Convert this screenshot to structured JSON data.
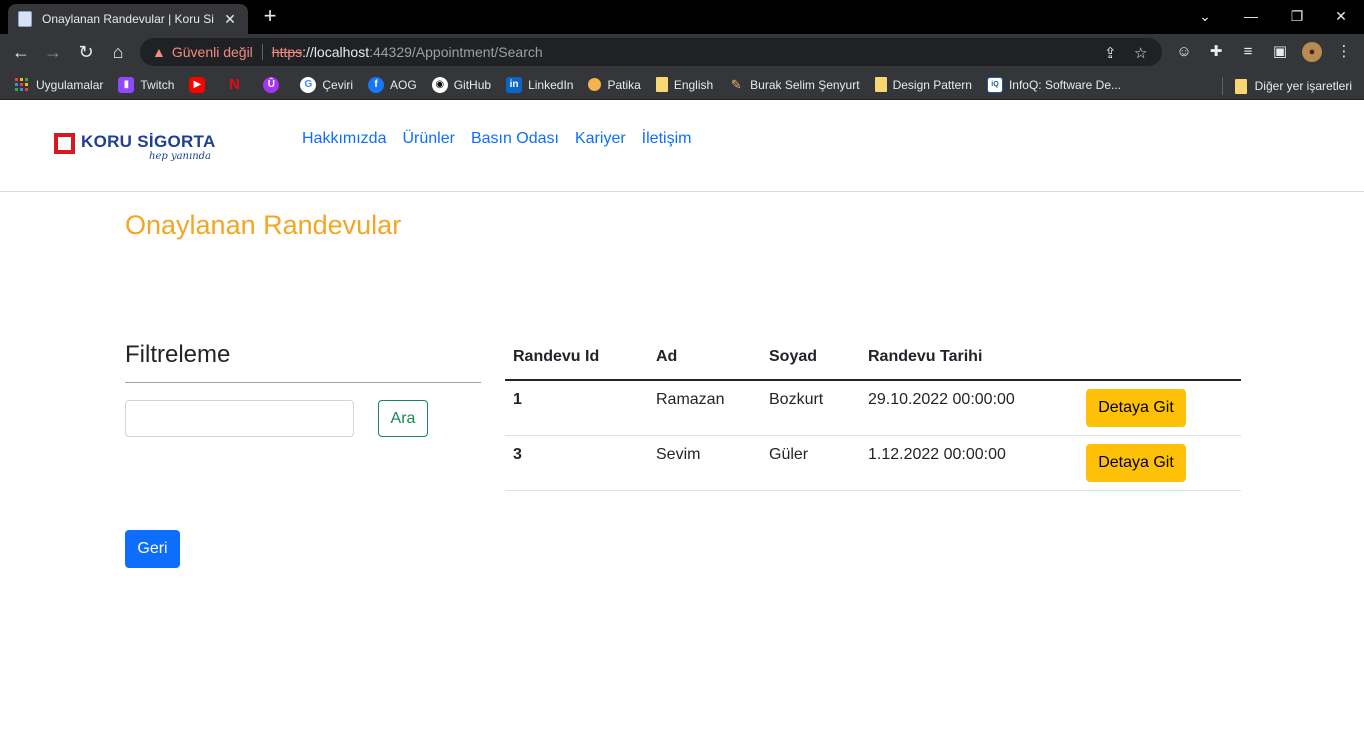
{
  "browser": {
    "tab_title": "Onaylanan Randevular | Koru Sigorta",
    "tab_close": "✕",
    "new_tab": "+",
    "window_controls": {
      "minimize": "—",
      "restore": "❐",
      "close": "✕"
    },
    "nav": {
      "back": "←",
      "forward": "→",
      "reload": "↻",
      "home": "⌂"
    },
    "security_label": "Güvenli değil",
    "url_scheme": "https",
    "url_host": "://localhost",
    "url_rest": ":44329/Appointment/Search",
    "bookmarks": [
      {
        "label": "Uygulamalar",
        "icon": "apps-grid-icon",
        "color": "#e8eaed"
      },
      {
        "label": "Twitch",
        "icon": "twitch-icon",
        "color": "#9146ff"
      },
      {
        "label": "",
        "icon": "youtube-icon",
        "color": "#ff0000"
      },
      {
        "label": "",
        "icon": "netflix-icon",
        "color": "#e50914"
      },
      {
        "label": "",
        "icon": "udemy-icon",
        "color": "#a435f0"
      },
      {
        "label": "Çeviri",
        "icon": "google-icon",
        "color": "#4285f4"
      },
      {
        "label": "AOG",
        "icon": "facebook-icon",
        "color": "#1877f2"
      },
      {
        "label": "GitHub",
        "icon": "github-icon",
        "color": "#ffffff"
      },
      {
        "label": "LinkedIn",
        "icon": "linkedin-icon",
        "color": "#0a66c2"
      },
      {
        "label": "Patika",
        "icon": "patika-icon",
        "color": "#f6b24d"
      },
      {
        "label": "English",
        "icon": "folder-icon",
        "color": "#f7d774"
      },
      {
        "label": "Burak Selim Şenyurt",
        "icon": "pen-icon",
        "color": "#f2b66d"
      },
      {
        "label": "Design Pattern",
        "icon": "folder-icon",
        "color": "#f7d774"
      },
      {
        "label": "InfoQ: Software De...",
        "icon": "infoq-icon",
        "color": "#ffffff"
      }
    ],
    "other_bookmarks": "Diğer yer işaretleri"
  },
  "site": {
    "logo_name": "KORU SİGORTA",
    "logo_tagline": "hep yanında",
    "nav": [
      "Hakkımızda",
      "Ürünler",
      "Basın Odası",
      "Kariyer",
      "İletişim"
    ]
  },
  "main": {
    "title": "Onaylanan Randevular",
    "filter_title": "Filtreleme",
    "search_value": "",
    "search_button": "Ara",
    "back_button": "Geri",
    "table": {
      "headers": [
        "Randevu Id",
        "Ad",
        "Soyad",
        "Randevu Tarihi",
        ""
      ],
      "rows": [
        {
          "id": "1",
          "ad": "Ramazan",
          "soyad": "Bozkurt",
          "tarih": "29.10.2022 00:00:00",
          "action": "Detaya Git"
        },
        {
          "id": "3",
          "ad": "Sevim",
          "soyad": "Güler",
          "tarih": "1.12.2022 00:00:00",
          "action": "Detaya Git"
        }
      ]
    }
  },
  "colors": {
    "title_orange": "#f4a623",
    "link_blue": "#0d6efd",
    "warning_yellow": "#ffc107",
    "success_green": "#198754"
  }
}
